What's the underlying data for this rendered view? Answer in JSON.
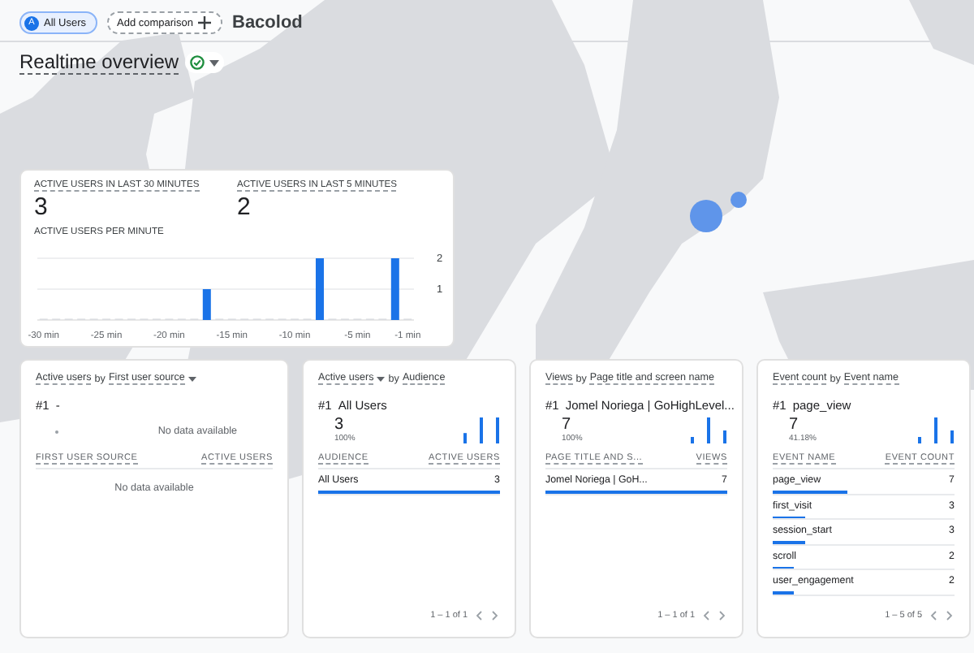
{
  "header": {
    "segment": {
      "badge": "A",
      "label": "All Users"
    },
    "add_comparison": "Add comparison",
    "location": "Bacolod"
  },
  "title": "Realtime overview",
  "overview": {
    "metrics": [
      {
        "label": "ACTIVE USERS IN LAST 30 MINUTES",
        "value": "3"
      },
      {
        "label": "ACTIVE USERS IN LAST 5 MINUTES",
        "value": "2"
      }
    ],
    "chart_label": "ACTIVE USERS PER MINUTE",
    "chart_data": {
      "type": "bar",
      "x": [
        -30,
        -29,
        -28,
        -27,
        -26,
        -25,
        -24,
        -23,
        -22,
        -21,
        -20,
        -19,
        -18,
        -17,
        -16,
        -15,
        -14,
        -13,
        -12,
        -11,
        -10,
        -9,
        -8,
        -7,
        -6,
        -5,
        -4,
        -3,
        -2,
        -1
      ],
      "values": [
        0,
        0,
        0,
        0,
        0,
        0,
        0,
        0,
        0,
        0,
        0,
        0,
        0,
        1,
        0,
        0,
        0,
        0,
        0,
        0,
        0,
        0,
        2,
        0,
        0,
        0,
        0,
        0,
        2,
        0
      ],
      "xticks": [
        {
          "value": -30,
          "label": "-30 min"
        },
        {
          "value": -25,
          "label": "-25 min"
        },
        {
          "value": -20,
          "label": "-20 min"
        },
        {
          "value": -15,
          "label": "-15 min"
        },
        {
          "value": -10,
          "label": "-10 min"
        },
        {
          "value": -5,
          "label": "-5 min"
        },
        {
          "value": -1,
          "label": "-1 min"
        }
      ],
      "xlim": [
        -30.5,
        -0.5
      ],
      "yticks": [
        1,
        2
      ],
      "ylim": [
        0,
        2
      ]
    }
  },
  "cards": [
    {
      "kind": "empty",
      "metric": "Active users",
      "joiner": "by",
      "dimension": "First user source",
      "metric_menu": false,
      "dimension_menu": true,
      "rank": "#1",
      "top": "-",
      "empty_text": "No data available",
      "columns": [
        "FIRST USER SOURCE",
        "ACTIVE USERS"
      ],
      "table_empty_text": "No data available"
    },
    {
      "kind": "data",
      "metric": "Active users",
      "joiner": "by",
      "dimension": "Audience",
      "metric_menu": true,
      "dimension_menu": false,
      "rank": "#1",
      "top": "All Users",
      "top_value": "3",
      "top_share": "100%",
      "columns": [
        "AUDIENCE",
        "ACTIVE USERS"
      ],
      "rows": [
        {
          "name": "All Users",
          "value": "3",
          "level": 1
        }
      ],
      "pager": "1 – 1 of 1"
    },
    {
      "kind": "data",
      "metric": "Views",
      "joiner": "by",
      "dimension": "Page title and screen name",
      "metric_menu": false,
      "dimension_menu": false,
      "rank": "#1",
      "top": "Jomel Noriega | GoHighLevel...",
      "top_value": "7",
      "top_share": "100%",
      "columns": [
        "PAGE TITLE AND S...",
        "VIEWS"
      ],
      "rows": [
        {
          "name": "Jomel Noriega | GoH...",
          "value": "7",
          "level": 1
        }
      ],
      "pager": "1 – 1 of 1"
    },
    {
      "kind": "data",
      "metric": "Event count",
      "joiner": "by",
      "dimension": "Event name",
      "metric_menu": false,
      "dimension_menu": false,
      "rank": "#1",
      "top": "page_view",
      "top_value": "7",
      "top_share": "41.18%",
      "columns": [
        "EVENT NAME",
        "EVENT COUNT"
      ],
      "rows": [
        {
          "name": "page_view",
          "value": "7",
          "level": 0.41
        },
        {
          "name": "first_visit",
          "value": "3",
          "level": 0.18
        },
        {
          "name": "session_start",
          "value": "3",
          "level": 0.18
        },
        {
          "name": "scroll",
          "value": "2",
          "level": 0.12
        },
        {
          "name": "user_engagement",
          "value": "2",
          "level": 0.12
        }
      ],
      "pager": "1 – 5 of 5"
    }
  ]
}
